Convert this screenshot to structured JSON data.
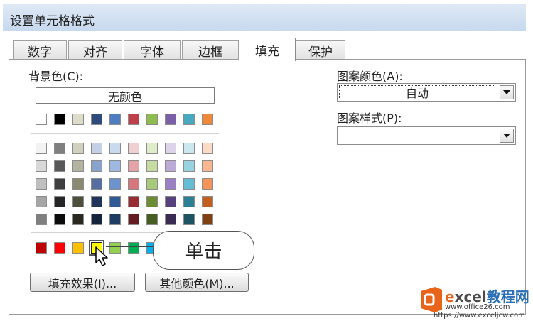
{
  "window": {
    "title": "设置单元格格式"
  },
  "tabs": [
    {
      "label": "数字",
      "active": false
    },
    {
      "label": "对齐",
      "active": false
    },
    {
      "label": "字体",
      "active": false
    },
    {
      "label": "边框",
      "active": false
    },
    {
      "label": "填充",
      "active": true
    },
    {
      "label": "保护",
      "active": false
    }
  ],
  "background": {
    "label": "背景色(C):",
    "no_color_label": "无颜色",
    "theme_row": [
      "#ffffff",
      "#000000",
      "#dcdcc8",
      "#2f4b7c",
      "#4f7ec0",
      "#c0404a",
      "#8ebc4e",
      "#7b5fa8",
      "#46a9c0",
      "#f0883a"
    ],
    "shade_rows": [
      [
        "#f2f2f2",
        "#7f7f7f",
        "#d0d0c0",
        "#c3d0e6",
        "#c9d9ef",
        "#f0cfd0",
        "#deecc9",
        "#ddd4ea",
        "#cbe8f0",
        "#fbdbc6"
      ],
      [
        "#d8d8d8",
        "#595959",
        "#b3b39f",
        "#8aa3cc",
        "#9eb9e0",
        "#e4a3a6",
        "#c4dca2",
        "#bbaad6",
        "#97d2e1",
        "#f8b78e"
      ],
      [
        "#bfbfbf",
        "#3f3f3f",
        "#8a8a70",
        "#566fa0",
        "#6d93cc",
        "#d7767c",
        "#a7ca78",
        "#9a7fc3",
        "#66bcd2",
        "#f49458"
      ],
      [
        "#a5a5a5",
        "#262626",
        "#4e4e3c",
        "#203559",
        "#2f5a95",
        "#992b33",
        "#6a8c33",
        "#57417c",
        "#2d7f93",
        "#c25f1f"
      ],
      [
        "#7f7f7f",
        "#0c0c0c",
        "#28281e",
        "#15233b",
        "#1f3c63",
        "#661d22",
        "#465e22",
        "#3a2b52",
        "#1e5462",
        "#813f14"
      ]
    ],
    "standard_row": [
      "#c00000",
      "#ff0000",
      "#ffc000",
      "#ffff00",
      "#92d050",
      "#00b050",
      "#00b0f0"
    ],
    "selected_color": "#ffff00"
  },
  "pattern_color": {
    "label": "图案颜色(A):",
    "value": "自动"
  },
  "pattern_style": {
    "label": "图案样式(P):",
    "value": ""
  },
  "buttons": {
    "fill_effects": "填充效果(I)...",
    "more_colors": "其他颜色(M)..."
  },
  "callout": {
    "text": "单击"
  },
  "watermark": {
    "brand_e": "e",
    "brand_rest": "xcel",
    "brand_cn": "教程网",
    "url1": "www.office26.com",
    "url2": "https://www.exceljcw.com"
  }
}
